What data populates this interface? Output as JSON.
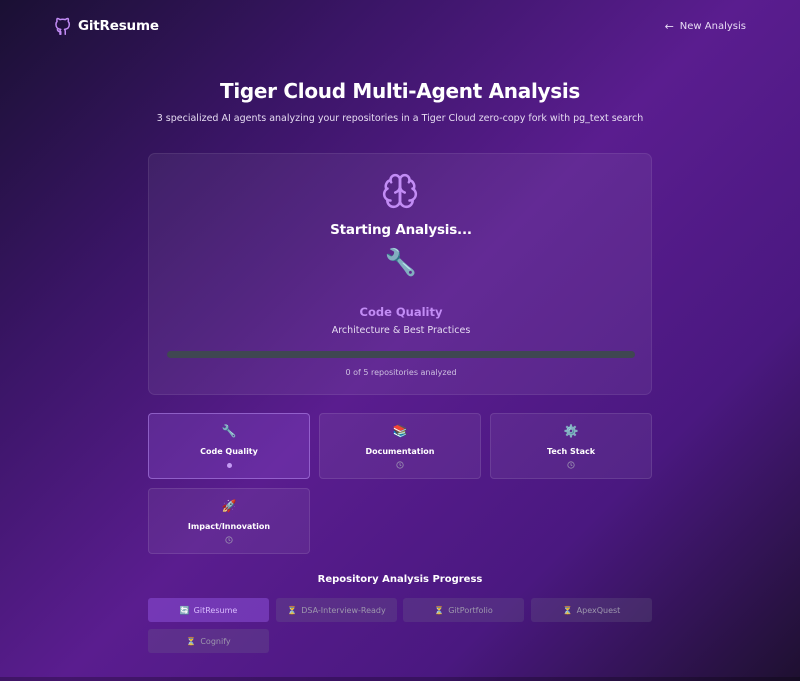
{
  "header": {
    "brand_name": "GitResume",
    "new_analysis_label": "New Analysis"
  },
  "page": {
    "title": "Tiger Cloud Multi-Agent Analysis",
    "subtitle": "3 specialized AI agents analyzing your repositories in a Tiger Cloud zero-copy fork with pg_text search"
  },
  "current": {
    "status": "Starting Analysis...",
    "agent_icon": "🔧",
    "agent_name": "Code Quality",
    "agent_description": "Architecture & Best Practices",
    "progress_percent": 0,
    "progress_text": "0 of 5 repositories analyzed"
  },
  "agents": [
    {
      "label": "Code Quality",
      "icon": "🔧",
      "state": "active"
    },
    {
      "label": "Documentation",
      "icon": "📚",
      "state": "pending"
    },
    {
      "label": "Tech Stack",
      "icon": "⚙️",
      "state": "pending"
    },
    {
      "label": "Impact/Innovation",
      "icon": "🚀",
      "state": "pending"
    }
  ],
  "repos": {
    "title": "Repository Analysis Progress",
    "items": [
      {
        "name": "GitResume",
        "icon": "🔄",
        "state": "active"
      },
      {
        "name": "DSA-Interview-Ready",
        "icon": "⏳",
        "state": "pending"
      },
      {
        "name": "GitPortfolio",
        "icon": "⏳",
        "state": "pending"
      },
      {
        "name": "ApexQuest",
        "icon": "⏳",
        "state": "pending"
      },
      {
        "name": "Cognify",
        "icon": "⏳",
        "state": "pending"
      }
    ]
  },
  "colors": {
    "accent": "#c28cf5",
    "progress_track": "#3f4751"
  }
}
